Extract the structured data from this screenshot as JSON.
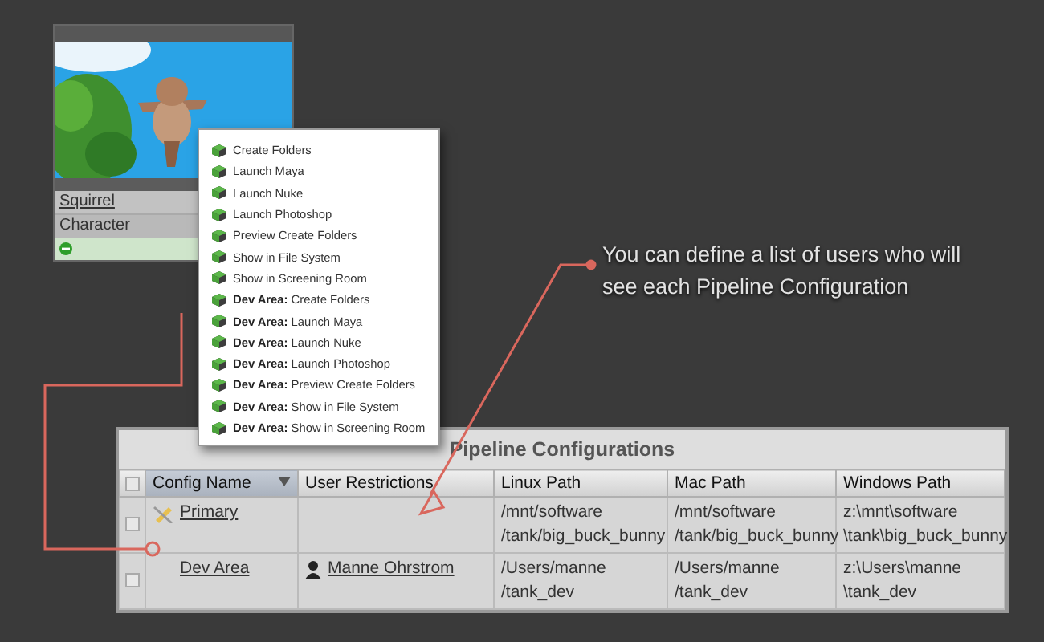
{
  "entity_card": {
    "title": "Squirrel",
    "type": "Character"
  },
  "context_menu": {
    "items": [
      {
        "label": "Create Folders"
      },
      {
        "label": "Launch Maya"
      },
      {
        "label": "Launch Nuke"
      },
      {
        "label": "Launch Photoshop"
      },
      {
        "label": "Preview Create Folders"
      },
      {
        "label": "Show in File System"
      },
      {
        "label": "Show in Screening Room"
      },
      {
        "label": "**Dev Area:** Create Folders"
      },
      {
        "label": "**Dev Area:** Launch Maya"
      },
      {
        "label": "**Dev Area:** Launch Nuke"
      },
      {
        "label": "**Dev Area:** Launch Photoshop"
      },
      {
        "label": "**Dev Area:** Preview Create Folders"
      },
      {
        "label": "**Dev Area:** Show in File System"
      },
      {
        "label": "**Dev Area:** Show in Screening Room"
      }
    ]
  },
  "callout": "You can define a list of users who will see each Pipeline Configuration",
  "table": {
    "title": "Pipeline Configurations",
    "all_checked": false,
    "columns": [
      {
        "label": "Config Name",
        "sorted": true
      },
      {
        "label": "User Restrictions",
        "sorted": false
      },
      {
        "label": "Linux Path",
        "sorted": false
      },
      {
        "label": "Mac Path",
        "sorted": false
      },
      {
        "label": "Windows Path",
        "sorted": false
      }
    ],
    "rows": [
      {
        "checked": false,
        "primary": true,
        "name": "Primary",
        "user": "",
        "linux": "/mnt/software\n/tank/big_buck_bunny",
        "mac": "/mnt/software\n/tank/big_buck_bunny",
        "windows": "z:\\mnt\\software\n\\tank\\big_buck_bunny"
      },
      {
        "checked": false,
        "primary": false,
        "name": "Dev Area",
        "user": "Manne Ohrstrom",
        "linux": "/Users/manne\n/tank_dev",
        "mac": "/Users/manne\n/tank_dev",
        "windows": "z:\\Users\\manne\n\\tank_dev"
      }
    ]
  }
}
